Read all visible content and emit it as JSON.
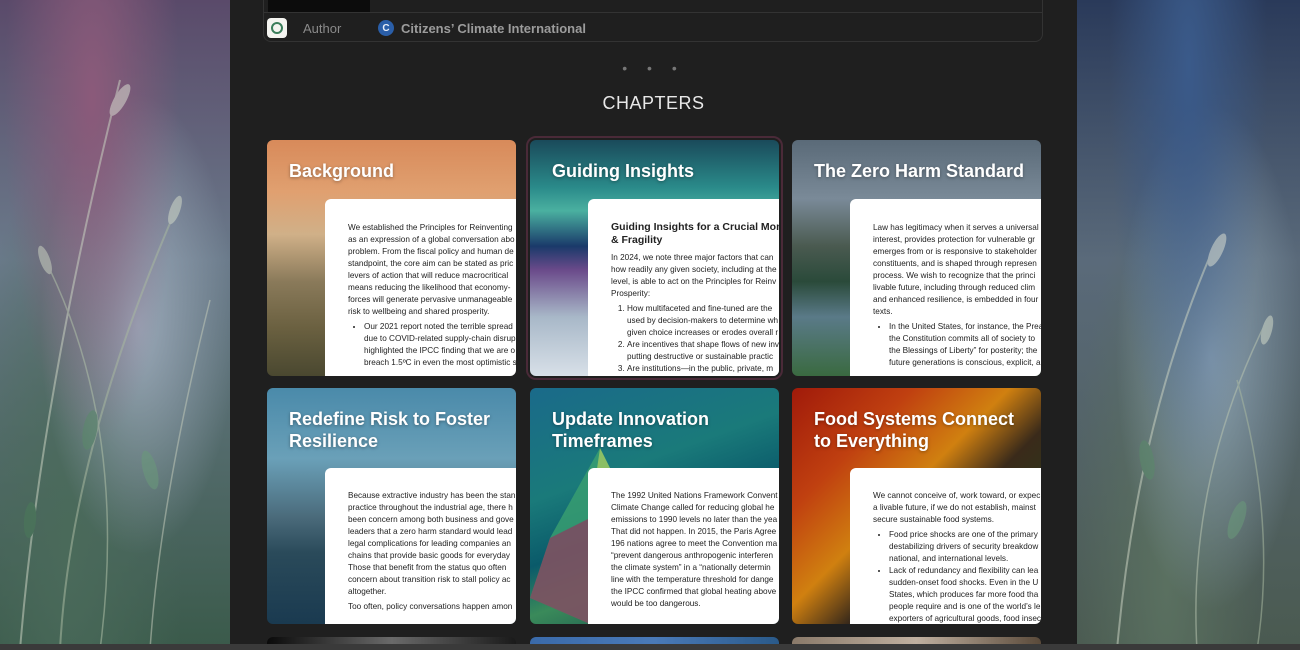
{
  "author": {
    "label": "Author",
    "org_icon": "ci-logo-icon",
    "org_icon_glyph": "C",
    "name": "Citizens’ Climate International"
  },
  "separator": "• • •",
  "heading": "CHAPTERS",
  "cards": [
    {
      "title": "Background",
      "doc_lines": [
        "We established the Principles for Reinventing",
        "as an expression of a global conversation abo",
        "problem. From the fiscal policy and human de",
        "standpoint, the core aim can be stated as pric",
        "levers of action that will reduce macrocritical",
        "means reducing the likelihood that economy-",
        "forces will generate pervasive unmanageable",
        "risk to wellbeing and shared prosperity."
      ],
      "bullets": [
        "Our 2021 report noted the terrible spread",
        "due to COVID-related supply-chain disrup",
        "highlighted the IPCC finding that we are o",
        "breach 1.5ºC in even the most optimistic s"
      ]
    },
    {
      "title": "Guiding Insights",
      "doc_heading": "Guiding Insights for a Crucial Mom Risk & Fragility",
      "doc_lines": [
        "In 2024, we note three major factors that can",
        "how readily any given society, including at the",
        "level, is able to act on the Principles for Reinv",
        "Prosperity:"
      ],
      "numbered": [
        "How multifaceted and fine-tuned are the",
        "used by decision-makers to determine wh",
        "given choice increases or erodes overall r",
        "Are incentives that shape flows of new inv",
        "putting destructive or sustainable practic",
        "Are institutions—in the public, private, m"
      ]
    },
    {
      "title": "The Zero Harm Standard",
      "doc_lines": [
        "Law has legitimacy when it serves a universal",
        "interest, provides protection for vulnerable gr",
        "emerges from or is responsive to stakeholder",
        "constituents, and is shaped through represen",
        "process. We wish to recognize that the princi",
        "livable future, including through reduced clim",
        "and enhanced resilience, is embedded in four",
        "texts."
      ],
      "bullets": [
        "In the United States, for instance, the Prea",
        "the Constitution commits all of society to",
        "the Blessings of Liberty” for posterity; the",
        "future generations is conscious, explicit, a"
      ]
    },
    {
      "title": "Redefine Risk to Foster Resilience",
      "doc_lines": [
        "Because extractive industry has been the stan",
        "practice throughout the industrial age, there h",
        "been concern among both business and gove",
        "leaders that a zero harm standard would lead",
        "legal complications for leading companies an",
        "chains that provide basic goods for everyday",
        "Those that benefit from the status quo often",
        "concern about transition risk to stall policy ac",
        "altogether.",
        "Too often, policy conversations happen amon"
      ]
    },
    {
      "title": "Update Innovation Timeframes",
      "doc_lines": [
        "The 1992 United Nations Framework Convent",
        "Climate Change called for reducing global he",
        "emissions to 1990 levels no later than the yea",
        "That did not happen. In 2015, the Paris Agree",
        "196 nations agree to meet the Convention ma",
        "“prevent dangerous anthropogenic interferen",
        "the climate system” in a “nationally determin",
        "line with the temperature threshold for dange",
        "the IPCC confirmed that global heating above",
        "would be too dangerous."
      ]
    },
    {
      "title": "Food Systems Connect to Everything",
      "doc_lines": [
        "We cannot conceive of, work toward, or expec",
        "a livable future, if we do not establish, mainst",
        "secure sustainable food systems."
      ],
      "bullets": [
        "Food price shocks are one of the primary",
        "destabilizing drivers of security breakdow",
        "national, and international levels.",
        "Lack of redundancy and flexibility can lea",
        "sudden-onset food shocks. Even in the U",
        "States, which produces far more food tha",
        "people require and is one of the world’s le",
        "exporters of agricultural goods, food insec"
      ]
    }
  ]
}
